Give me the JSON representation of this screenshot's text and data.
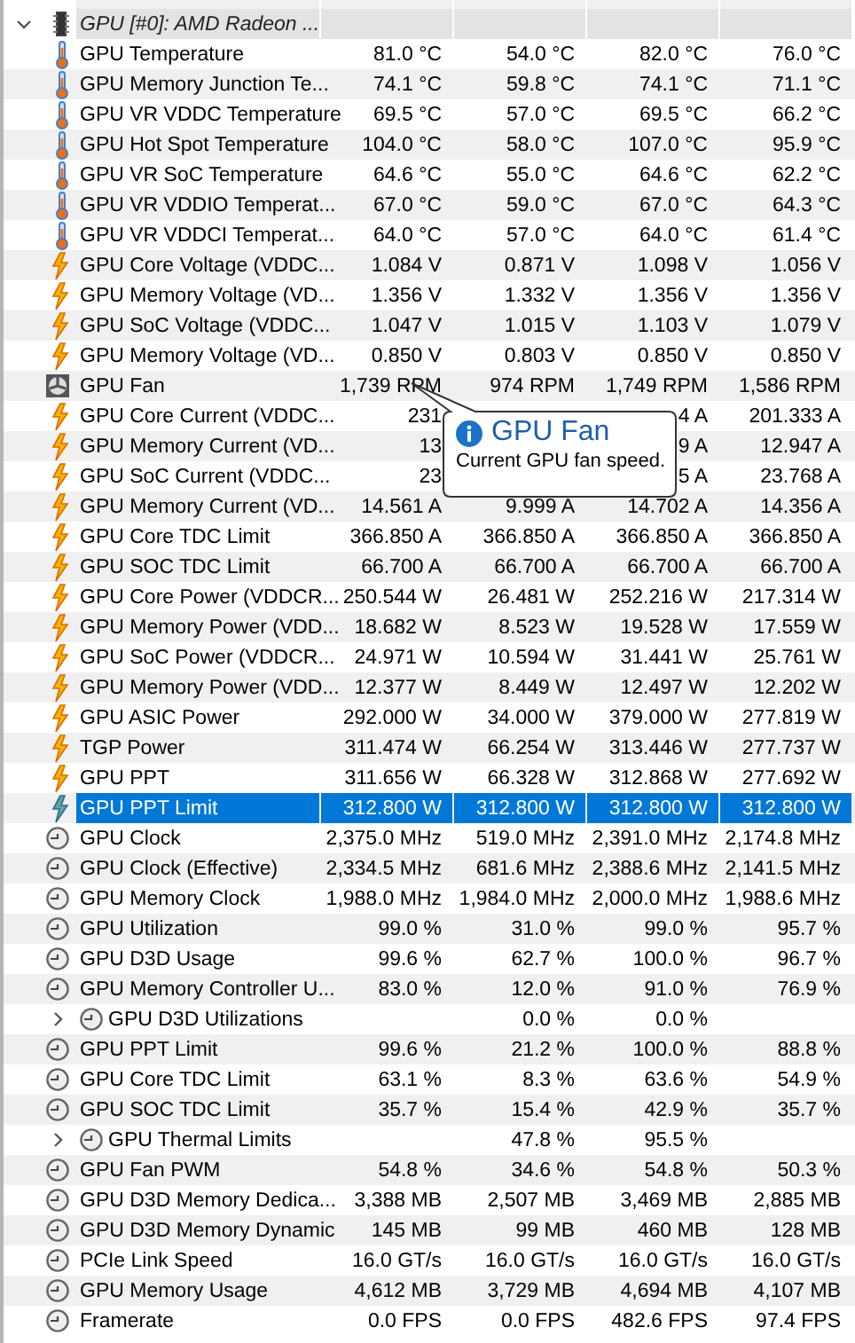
{
  "group": {
    "title": "GPU [#0]: AMD Radeon ...",
    "expanded": true
  },
  "rows": [
    {
      "kind": "temperature",
      "name": "GPU Temperature",
      "values": {
        "column_1": "81.0 °C",
        "column_2": "54.0 °C",
        "column_3": "82.0 °C",
        "column_4": "76.0 °C"
      },
      "selected": false
    },
    {
      "kind": "temperature",
      "name": "GPU Memory Junction Te...",
      "values": {
        "column_1": "74.1 °C",
        "column_2": "59.8 °C",
        "column_3": "74.1 °C",
        "column_4": "71.1 °C"
      },
      "selected": false
    },
    {
      "kind": "temperature",
      "name": "GPU VR VDDC Temperature",
      "values": {
        "column_1": "69.5 °C",
        "column_2": "57.0 °C",
        "column_3": "69.5 °C",
        "column_4": "66.2 °C"
      },
      "selected": false
    },
    {
      "kind": "temperature",
      "name": "GPU Hot Spot Temperature",
      "values": {
        "column_1": "104.0 °C",
        "column_2": "58.0 °C",
        "column_3": "107.0 °C",
        "column_4": "95.9 °C"
      },
      "selected": false
    },
    {
      "kind": "temperature",
      "name": "GPU VR SoC Temperature",
      "values": {
        "column_1": "64.6 °C",
        "column_2": "55.0 °C",
        "column_3": "64.6 °C",
        "column_4": "62.2 °C"
      },
      "selected": false
    },
    {
      "kind": "temperature",
      "name": "GPU VR VDDIO Temperat...",
      "values": {
        "column_1": "67.0 °C",
        "column_2": "59.0 °C",
        "column_3": "67.0 °C",
        "column_4": "64.3 °C"
      },
      "selected": false
    },
    {
      "kind": "temperature",
      "name": "GPU VR VDDCI Temperat...",
      "values": {
        "column_1": "64.0 °C",
        "column_2": "57.0 °C",
        "column_3": "64.0 °C",
        "column_4": "61.4 °C"
      },
      "selected": false
    },
    {
      "kind": "electric",
      "name": "GPU Core Voltage (VDDC...",
      "values": {
        "column_1": "1.084 V",
        "column_2": "0.871 V",
        "column_3": "1.098 V",
        "column_4": "1.056 V"
      },
      "selected": false
    },
    {
      "kind": "electric",
      "name": "GPU Memory Voltage (VD...",
      "values": {
        "column_1": "1.356 V",
        "column_2": "1.332 V",
        "column_3": "1.356 V",
        "column_4": "1.356 V"
      },
      "selected": false
    },
    {
      "kind": "electric",
      "name": "GPU SoC Voltage (VDDC...",
      "values": {
        "column_1": "1.047 V",
        "column_2": "1.015 V",
        "column_3": "1.103 V",
        "column_4": "1.079 V"
      },
      "selected": false
    },
    {
      "kind": "electric",
      "name": "GPU Memory Voltage (VD...",
      "values": {
        "column_1": "0.850 V",
        "column_2": "0.803 V",
        "column_3": "0.850 V",
        "column_4": "0.850 V"
      },
      "selected": false
    },
    {
      "kind": "fan",
      "name": "GPU Fan",
      "values": {
        "column_1": "1,739 RPM",
        "column_2": "974 RPM",
        "column_3": "1,749 RPM",
        "column_4": "1,586 RPM"
      },
      "selected": false
    },
    {
      "kind": "electric",
      "name": "GPU Core Current (VDDC...",
      "values": {
        "column_1": "231",
        "column_3": "4 A",
        "column_4": "201.333 A"
      },
      "selected": false
    },
    {
      "kind": "electric",
      "name": "GPU Memory Current (VD...",
      "values": {
        "column_1": "13",
        "column_3": "9 A",
        "column_4": "12.947 A"
      },
      "selected": false
    },
    {
      "kind": "electric",
      "name": "GPU SoC Current (VDDC...",
      "values": {
        "column_1": "23",
        "column_3": "5 A",
        "column_4": "23.768 A"
      },
      "selected": false
    },
    {
      "kind": "electric",
      "name": "GPU Memory Current (VD...",
      "values": {
        "column_1": "14.561 A",
        "column_2": "9.999 A",
        "column_3": "14.702 A",
        "column_4": "14.356 A"
      },
      "selected": false
    },
    {
      "kind": "electric",
      "name": "GPU Core TDC Limit",
      "values": {
        "column_1": "366.850 A",
        "column_2": "366.850 A",
        "column_3": "366.850 A",
        "column_4": "366.850 A"
      },
      "selected": false
    },
    {
      "kind": "electric",
      "name": "GPU SOC TDC Limit",
      "values": {
        "column_1": "66.700 A",
        "column_2": "66.700 A",
        "column_3": "66.700 A",
        "column_4": "66.700 A"
      },
      "selected": false
    },
    {
      "kind": "electric",
      "name": "GPU Core Power (VDDCR...",
      "values": {
        "column_1": "250.544 W",
        "column_2": "26.481 W",
        "column_3": "252.216 W",
        "column_4": "217.314 W"
      },
      "selected": false
    },
    {
      "kind": "electric",
      "name": "GPU Memory Power (VDD...",
      "values": {
        "column_1": "18.682 W",
        "column_2": "8.523 W",
        "column_3": "19.528 W",
        "column_4": "17.559 W"
      },
      "selected": false
    },
    {
      "kind": "electric",
      "name": "GPU SoC Power (VDDCR...",
      "values": {
        "column_1": "24.971 W",
        "column_2": "10.594 W",
        "column_3": "31.441 W",
        "column_4": "25.761 W"
      },
      "selected": false
    },
    {
      "kind": "electric",
      "name": "GPU Memory Power (VDD...",
      "values": {
        "column_1": "12.377 W",
        "column_2": "8.449 W",
        "column_3": "12.497 W",
        "column_4": "12.202 W"
      },
      "selected": false
    },
    {
      "kind": "electric",
      "name": "GPU ASIC Power",
      "values": {
        "column_1": "292.000 W",
        "column_2": "34.000 W",
        "column_3": "379.000 W",
        "column_4": "277.819 W"
      },
      "selected": false
    },
    {
      "kind": "electric",
      "name": "TGP Power",
      "values": {
        "column_1": "311.474 W",
        "column_2": "66.254 W",
        "column_3": "313.446 W",
        "column_4": "277.737 W"
      },
      "selected": false
    },
    {
      "kind": "electric",
      "name": "GPU PPT",
      "values": {
        "column_1": "311.656 W",
        "column_2": "66.328 W",
        "column_3": "312.868 W",
        "column_4": "277.692 W"
      },
      "selected": false
    },
    {
      "kind": "electric",
      "name": "GPU PPT Limit",
      "values": {
        "column_1": "312.800 W",
        "column_2": "312.800 W",
        "column_3": "312.800 W",
        "column_4": "312.800 W"
      },
      "selected": true
    },
    {
      "kind": "clock",
      "name": "GPU Clock",
      "values": {
        "column_1": "2,375.0 MHz",
        "column_2": "519.0 MHz",
        "column_3": "2,391.0 MHz",
        "column_4": "2,174.8 MHz"
      },
      "selected": false
    },
    {
      "kind": "clock",
      "name": "GPU Clock (Effective)",
      "values": {
        "column_1": "2,334.5 MHz",
        "column_2": "681.6 MHz",
        "column_3": "2,388.6 MHz",
        "column_4": "2,141.5 MHz"
      },
      "selected": false
    },
    {
      "kind": "clock",
      "name": "GPU Memory Clock",
      "values": {
        "column_1": "1,988.0 MHz",
        "column_2": "1,984.0 MHz",
        "column_3": "2,000.0 MHz",
        "column_4": "1,988.6 MHz"
      },
      "selected": false
    },
    {
      "kind": "clock",
      "name": "GPU Utilization",
      "values": {
        "column_1": "99.0 %",
        "column_2": "31.0 %",
        "column_3": "99.0 %",
        "column_4": "95.7 %"
      },
      "selected": false
    },
    {
      "kind": "clock",
      "name": "GPU D3D Usage",
      "values": {
        "column_1": "99.6 %",
        "column_2": "62.7 %",
        "column_3": "100.0 %",
        "column_4": "96.7 %"
      },
      "selected": false
    },
    {
      "kind": "clock",
      "name": "GPU Memory Controller U...",
      "values": {
        "column_1": "83.0 %",
        "column_2": "12.0 %",
        "column_3": "91.0 %",
        "column_4": "76.9 %"
      },
      "selected": false
    },
    {
      "kind": "clock",
      "name": "GPU D3D Utilizations",
      "values": {
        "column_2": "0.0 %",
        "column_3": "0.0 %"
      },
      "selected": false,
      "expanded": false
    },
    {
      "kind": "clock",
      "name": "GPU PPT Limit",
      "values": {
        "column_1": "99.6 %",
        "column_2": "21.2 %",
        "column_3": "100.0 %",
        "column_4": "88.8 %"
      },
      "selected": false
    },
    {
      "kind": "clock",
      "name": "GPU Core TDC Limit",
      "values": {
        "column_1": "63.1 %",
        "column_2": "8.3 %",
        "column_3": "63.6 %",
        "column_4": "54.9 %"
      },
      "selected": false
    },
    {
      "kind": "clock",
      "name": "GPU SOC TDC Limit",
      "values": {
        "column_1": "35.7 %",
        "column_2": "15.4 %",
        "column_3": "42.9 %",
        "column_4": "35.7 %"
      },
      "selected": false
    },
    {
      "kind": "clock",
      "name": "GPU Thermal Limits",
      "values": {
        "column_2": "47.8 %",
        "column_3": "95.5 %"
      },
      "selected": false,
      "expanded": false
    },
    {
      "kind": "clock",
      "name": "GPU Fan PWM",
      "values": {
        "column_1": "54.8 %",
        "column_2": "34.6 %",
        "column_3": "54.8 %",
        "column_4": "50.3 %"
      },
      "selected": false
    },
    {
      "kind": "clock",
      "name": "GPU D3D Memory Dedica...",
      "values": {
        "column_1": "3,388 MB",
        "column_2": "2,507 MB",
        "column_3": "3,469 MB",
        "column_4": "2,885 MB"
      },
      "selected": false
    },
    {
      "kind": "clock",
      "name": "GPU D3D Memory Dynamic",
      "values": {
        "column_1": "145 MB",
        "column_2": "99 MB",
        "column_3": "460 MB",
        "column_4": "128 MB"
      },
      "selected": false
    },
    {
      "kind": "clock",
      "name": "PCIe Link Speed",
      "values": {
        "column_1": "16.0 GT/s",
        "column_2": "16.0 GT/s",
        "column_3": "16.0 GT/s",
        "column_4": "16.0 GT/s"
      },
      "selected": false
    },
    {
      "kind": "clock",
      "name": "GPU Memory Usage",
      "values": {
        "column_1": "4,612 MB",
        "column_2": "3,729 MB",
        "column_3": "4,694 MB",
        "column_4": "4,107 MB"
      },
      "selected": false
    },
    {
      "kind": "clock",
      "name": "Framerate",
      "values": {
        "column_1": "0.0 FPS",
        "column_2": "0.0 FPS",
        "column_3": "482.6 FPS",
        "column_4": "97.4 FPS"
      },
      "selected": false
    }
  ],
  "tooltip": {
    "title": "GPU Fan",
    "text": "Current GPU fan speed."
  }
}
